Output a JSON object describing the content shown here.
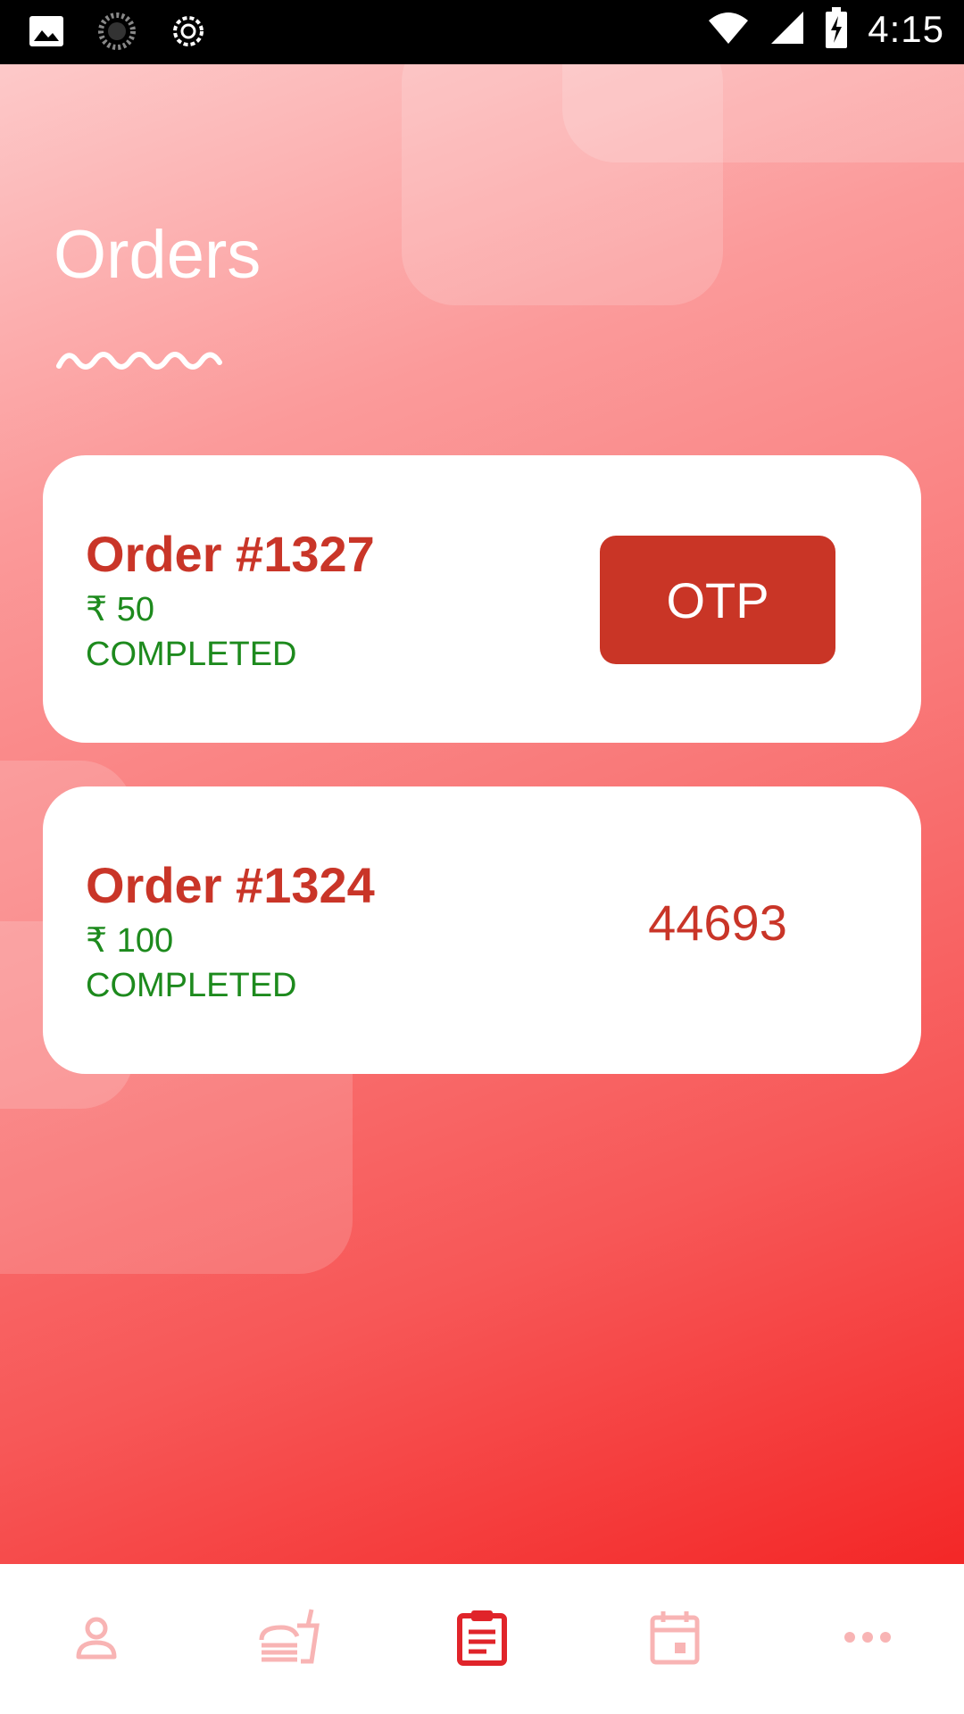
{
  "status_bar": {
    "time": "4:15",
    "icons": [
      "image-icon",
      "loading-icon",
      "usb-debug-icon",
      "wifi-icon",
      "signal-icon",
      "battery-charging-icon"
    ]
  },
  "page": {
    "title": "Orders"
  },
  "orders": [
    {
      "title": "Order #1327",
      "amount": "₹ 50",
      "status": "COMPLETED",
      "action_label": "OTP"
    },
    {
      "title": "Order #1324",
      "amount": "₹ 100",
      "status": "COMPLETED",
      "otp_code": "44693"
    }
  ],
  "bottom_nav": {
    "items": [
      "profile-icon",
      "food-icon",
      "orders-icon",
      "calendar-icon",
      "more-icon"
    ],
    "active": "orders-icon"
  },
  "colors": {
    "accent": "#c93528",
    "success": "#1d8a1d",
    "nav_inactive": "#f8b4b4",
    "nav_active": "#e0242a"
  }
}
